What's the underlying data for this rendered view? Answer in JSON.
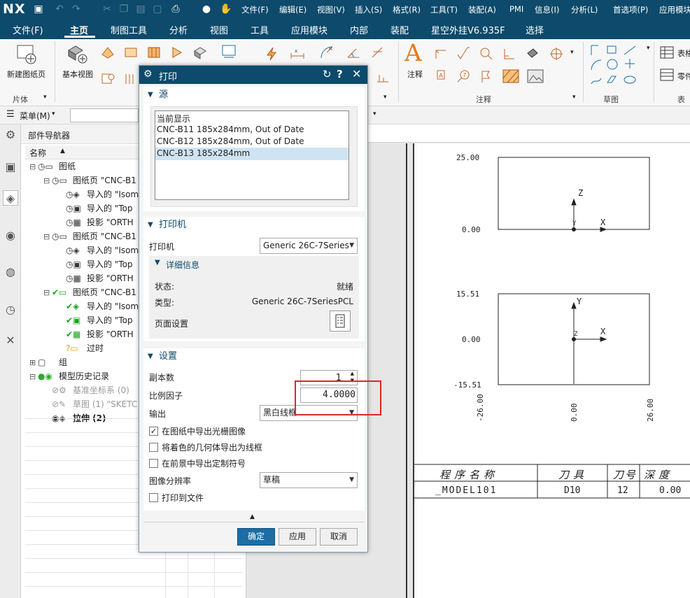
{
  "app": {
    "logo": "NX",
    "menus": [
      "文件(F)",
      "编辑(E)",
      "视图(V)",
      "插入(S)",
      "格式(R)",
      "工具(T)",
      "装配(A)",
      "PMI",
      "信息(I)",
      "分析(L)",
      "首选项(P)",
      "应用模块"
    ]
  },
  "ribbon": {
    "tabs": [
      "文件(F)",
      "主页",
      "制图工具",
      "分析",
      "视图",
      "工具",
      "应用模块",
      "内部",
      "装配",
      "星空外挂V6.935F",
      "选择"
    ],
    "active_tab": "主页",
    "new_sheet": "新建图纸页",
    "base_view": "基本视图",
    "group_sheet": "片体",
    "note": "注释",
    "group_note": "注释",
    "group_sketch": "草图",
    "table_label": "表格",
    "parts_label": "零件",
    "group_table": "表"
  },
  "menubar": {
    "menu": "菜单(M)"
  },
  "navigator": {
    "title": "部件导航器",
    "col_name": "名称",
    "rows": [
      {
        "text": "图纸"
      },
      {
        "text": "图纸页 \"CNC-B1"
      },
      {
        "text": "导入的 \"Isom"
      },
      {
        "text": "导入的 \"Top"
      },
      {
        "text": "投影 \"ORTH"
      },
      {
        "text": "图纸页 \"CNC-B1"
      },
      {
        "text": "导入的 \"Isom"
      },
      {
        "text": "导入的 \"Top"
      },
      {
        "text": "投影 \"ORTH"
      },
      {
        "text": "图纸页 \"CNC-B1"
      },
      {
        "text": "导入的 \"Isom"
      },
      {
        "text": "导入的 \"Top"
      },
      {
        "text": "投影 \"ORTH"
      },
      {
        "text": "过时"
      },
      {
        "text": "组"
      },
      {
        "text": "模型历史记录"
      },
      {
        "text": "基准坐标系 (0)"
      },
      {
        "text": "草图 (1) \"SKETC"
      },
      {
        "text": "拉伸 (2)"
      }
    ]
  },
  "dialog": {
    "title": "打印",
    "source_section": "源",
    "source_list": [
      "当前显示",
      "CNC-B11  185x284mm, Out of Date",
      "CNC-B12  185x284mm, Out of Date",
      "CNC-B13  185x284mm"
    ],
    "printer_section": "打印机",
    "printer_label": "打印机",
    "printer_value": "Generic 26C-7Series",
    "details_section": "详细信息",
    "status_label": "状态:",
    "status_value": "就绪",
    "type_label": "类型:",
    "type_value": "Generic 26C-7SeriesPCL",
    "page_setup": "页面设置",
    "settings_section": "设置",
    "copies_label": "副本数",
    "copies_value": "1",
    "scale_label": "比例因子",
    "scale_value": "4.0000",
    "output_label": "输出",
    "output_value": "黑白线框",
    "cb1": "在图纸中导出光栅图像",
    "cb1_checked": true,
    "cb2": "将着色的几何体导出为线框",
    "cb3": "在前景中导出定制符号",
    "resolution_label": "图像分辨率",
    "resolution_value": "草稿",
    "cb4": "打印到文件",
    "ok": "确定",
    "apply": "应用",
    "cancel": "取消"
  },
  "drawing": {
    "view1": {
      "top": "25.00",
      "bottom": "0.00"
    },
    "view2": {
      "top": "15.51",
      "mid": "0.00",
      "bottom": "-15.51"
    },
    "dims": [
      "-26.00",
      "0.00",
      "26.00"
    ],
    "axes": {
      "z": "Z",
      "x": "X",
      "y": "Y"
    },
    "table": {
      "headers": [
        "程序名称",
        "刀具",
        "刀号",
        "深度"
      ],
      "row": [
        "_MODEL101",
        "D10",
        "12",
        "0.00"
      ]
    }
  },
  "colors": {
    "titlebar": "#0d4a6b",
    "highlight_box": "#e0262b",
    "selected_row": "#cfe4f3"
  }
}
